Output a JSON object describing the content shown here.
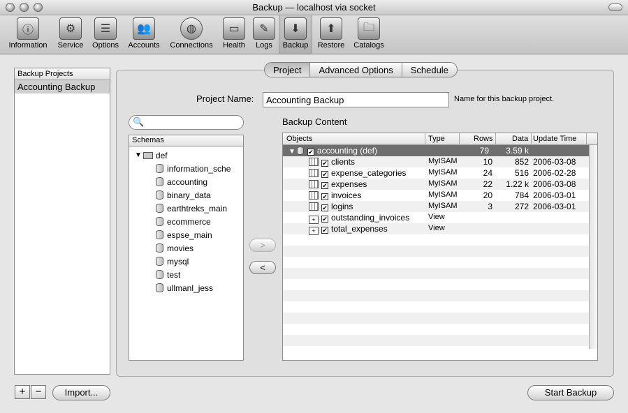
{
  "window": {
    "title": "Backup — localhost via socket"
  },
  "toolbar": {
    "items": [
      {
        "label": "Information",
        "icon": "information-icon"
      },
      {
        "label": "Service",
        "icon": "service-icon"
      },
      {
        "label": "Options",
        "icon": "options-icon"
      },
      {
        "label": "Accounts",
        "icon": "accounts-icon"
      },
      {
        "label": "Connections",
        "icon": "connections-icon"
      },
      {
        "label": "Health",
        "icon": "health-icon"
      },
      {
        "label": "Logs",
        "icon": "logs-icon"
      },
      {
        "label": "Backup",
        "icon": "backup-icon",
        "active": true
      },
      {
        "label": "Restore",
        "icon": "restore-icon"
      },
      {
        "label": "Catalogs",
        "icon": "catalogs-icon"
      }
    ]
  },
  "projects": {
    "header": "Backup Projects",
    "items": [
      "Accounting Backup"
    ]
  },
  "tabs": [
    "Project",
    "Advanced Options",
    "Schedule"
  ],
  "project": {
    "name_label": "Project Name:",
    "name_value": "Accounting Backup",
    "name_hint": "Name for this backup project."
  },
  "schemas": {
    "header": "Schemas",
    "root": "def",
    "items": [
      "information_sche",
      "accounting",
      "binary_data",
      "earthtreks_main",
      "ecommerce",
      "espse_main",
      "movies",
      "mysql",
      "test",
      "ullmanl_jess"
    ]
  },
  "transfer": {
    "add_label": ">",
    "remove_label": "<"
  },
  "backup_content": {
    "label": "Backup Content",
    "columns": [
      "Objects",
      "Type",
      "Rows",
      "Data",
      "Update Time"
    ],
    "root": {
      "name": "accounting (def)",
      "rows": "79",
      "data": "3.59 k"
    },
    "rows": [
      {
        "name": "clients",
        "type": "MyISAM",
        "rows": "10",
        "data": "852",
        "update": "2006-03-08"
      },
      {
        "name": "expense_categories",
        "type": "MyISAM",
        "rows": "24",
        "data": "516",
        "update": "2006-02-28"
      },
      {
        "name": "expenses",
        "type": "MyISAM",
        "rows": "22",
        "data": "1.22 k",
        "update": "2006-03-08"
      },
      {
        "name": "invoices",
        "type": "MyISAM",
        "rows": "20",
        "data": "784",
        "update": "2006-03-01"
      },
      {
        "name": "logins",
        "type": "MyISAM",
        "rows": "3",
        "data": "272",
        "update": "2006-03-01"
      },
      {
        "name": "outstanding_invoices",
        "type": "View",
        "rows": "",
        "data": "",
        "update": ""
      },
      {
        "name": "total_expenses",
        "type": "View",
        "rows": "",
        "data": "",
        "update": ""
      }
    ]
  },
  "footer": {
    "add": "+",
    "remove": "−",
    "import": "Import...",
    "start": "Start Backup"
  },
  "glyphs": {
    "checkmark": "✔",
    "expanded": "▼",
    "search": "🔍"
  }
}
